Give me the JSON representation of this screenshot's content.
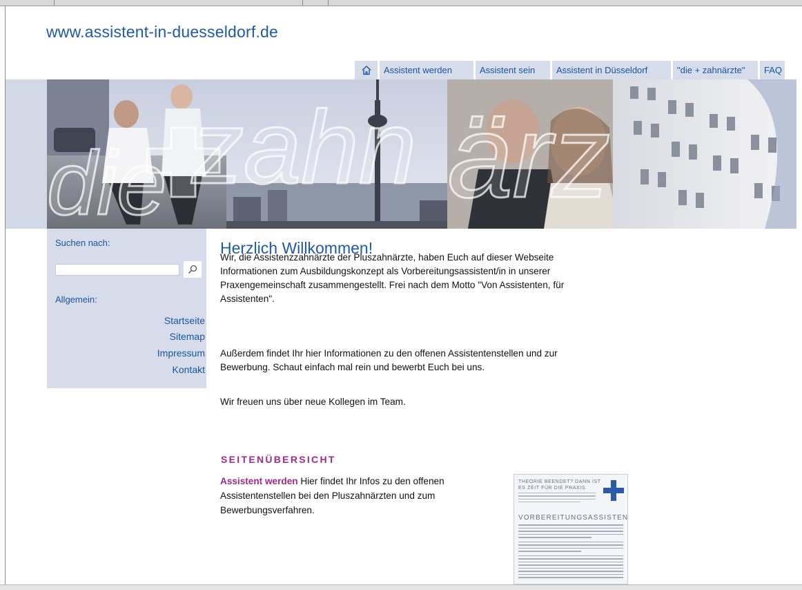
{
  "site": {
    "url_title": "www.assistent-in-duesseldorf.de"
  },
  "nav": {
    "items": [
      "Assistent werden",
      "Assistent sein",
      "Assistent in Düsseldorf",
      "\"die + zahnärzte\"",
      "FAQ"
    ]
  },
  "sidebar": {
    "search_label": "Suchen nach:",
    "search_value": "",
    "section_label": "Allgemein:",
    "links": [
      "Startseite",
      "Sitemap",
      "Impressum",
      "Kontakt"
    ]
  },
  "content": {
    "welcome_title": "Herzlich Willkommen!",
    "intro_lines": [
      "Wir, die Assistenzzahnärzte der Pluszahnärzte, haben Euch auf dieser Webseite",
      "Informationen zum Ausbildungskonzept als Vorbereitungsassistent/in in unserer",
      "Praxengemeinschaft zusammengestellt. Frei nach dem Motto \"Von Assistenten, für",
      "Assistenten\"."
    ],
    "info_lines": [
      "Außerdem findet Ihr hier Informationen zu den offenen Assistentenstellen und zur",
      "Bewerbung. Schaut einfach mal rein und bewerbt Euch bei uns."
    ],
    "closing": "Wir freuen uns über neue Kollegen im Team."
  },
  "overview": {
    "heading": "SEITENÜBERSICHT",
    "link_label": "Assistent werden",
    "description_lines": [
      " Hier findet Ihr Infos zu den offenen",
      "Assistentenstellen bei den Pluszahnärzten und zum",
      "Bewerbungsverfahren."
    ]
  },
  "flyer": {
    "headline_lines": [
      "THEORIE BEENDET? DANN IST",
      "ES ZEIT FÜR DIE PRAXIS."
    ],
    "title": "VORBEREITUNGSASSISTENT/IN"
  },
  "colors": {
    "link_blue": "#1a55a0",
    "accent_purple": "#a0288a",
    "nav_bg": "#d6dcea"
  },
  "icons": {
    "home": "home-icon",
    "search": "magnifier-icon"
  }
}
